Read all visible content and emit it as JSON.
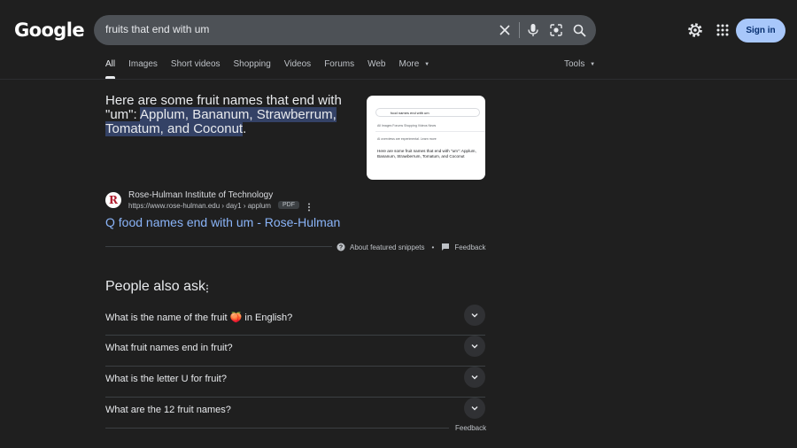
{
  "header": {
    "logo_text": "Google",
    "search_value": "fruits that end with um",
    "sign_in_label": "Sign in"
  },
  "tabs": [
    {
      "label": "All",
      "active": true
    },
    {
      "label": "Images"
    },
    {
      "label": "Short videos"
    },
    {
      "label": "Shopping"
    },
    {
      "label": "Videos"
    },
    {
      "label": "Forums"
    },
    {
      "label": "Web"
    },
    {
      "label": "More"
    }
  ],
  "tools_label": "Tools",
  "snippet": {
    "intro": "Here are some fruit names that end with \"um\":",
    "highlight": "Applum, Bananum, Strawberrum, Tomatum, and Coconut",
    "end": "."
  },
  "thumbnail": {
    "query": "food names end with um",
    "tabs": "All     Images     Forums     Shopping     Videos     News",
    "note": "AI overviews are experimental. Learn more",
    "text": "Here are some fruit names that end with \"um\": Applum, Bananum, Strawberrum, Tomatum, and Coconut"
  },
  "source": {
    "favicon_letter": "R",
    "name": "Rose-Hulman Institute of Technology",
    "url": "https://www.rose-hulman.edu › day1 › applum",
    "badge": "PDF"
  },
  "result_title": "Q food names end with um - Rose-Hulman",
  "about_label": "About featured snippets",
  "bullet": "•",
  "feedback_label": "Feedback",
  "people_also_ask": {
    "title": "People also ask",
    "questions": [
      "What is the name of the fruit 🍑 in English?",
      "What fruit names end in fruit?",
      "What is the letter U for fruit?",
      "What are the 12 fruit names?"
    ]
  },
  "feedback_bottom": "Feedback",
  "colors": {
    "background": "#1f1f1f",
    "link": "#8ab4f8",
    "sign_in_bg": "#a8c7fa",
    "highlight": "#344266"
  }
}
